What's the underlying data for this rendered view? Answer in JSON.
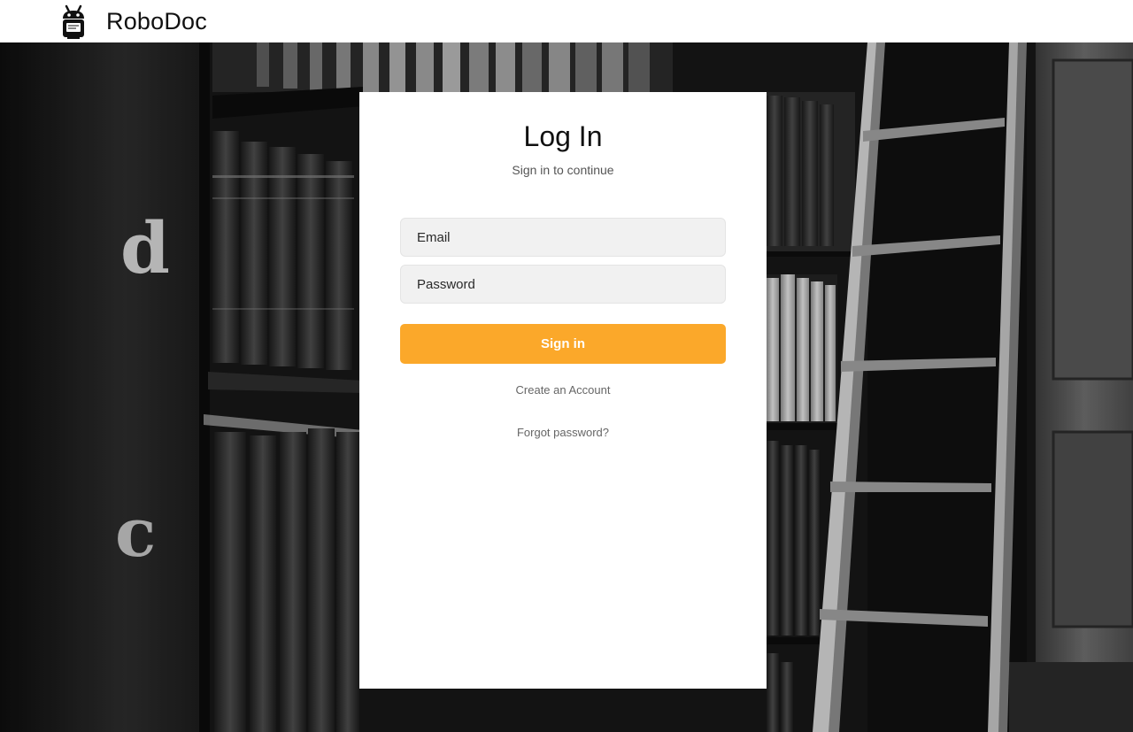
{
  "header": {
    "brand_name": "RoboDoc",
    "logo_icon": "robot-icon"
  },
  "background": {
    "description_icon": "library-bookshelf-image",
    "shelf_letters": [
      "d",
      "c"
    ]
  },
  "login": {
    "title": "Log In",
    "subtitle": "Sign in to continue",
    "email_placeholder": "Email",
    "email_value": "",
    "password_placeholder": "Password",
    "password_value": "",
    "signin_label": "Sign in",
    "create_account_label": "Create an Account",
    "forgot_password_label": "Forgot password?"
  },
  "colors": {
    "accent": "#fba82a",
    "field_bg": "#f1f1f1",
    "header_bg": "#ffffff"
  }
}
